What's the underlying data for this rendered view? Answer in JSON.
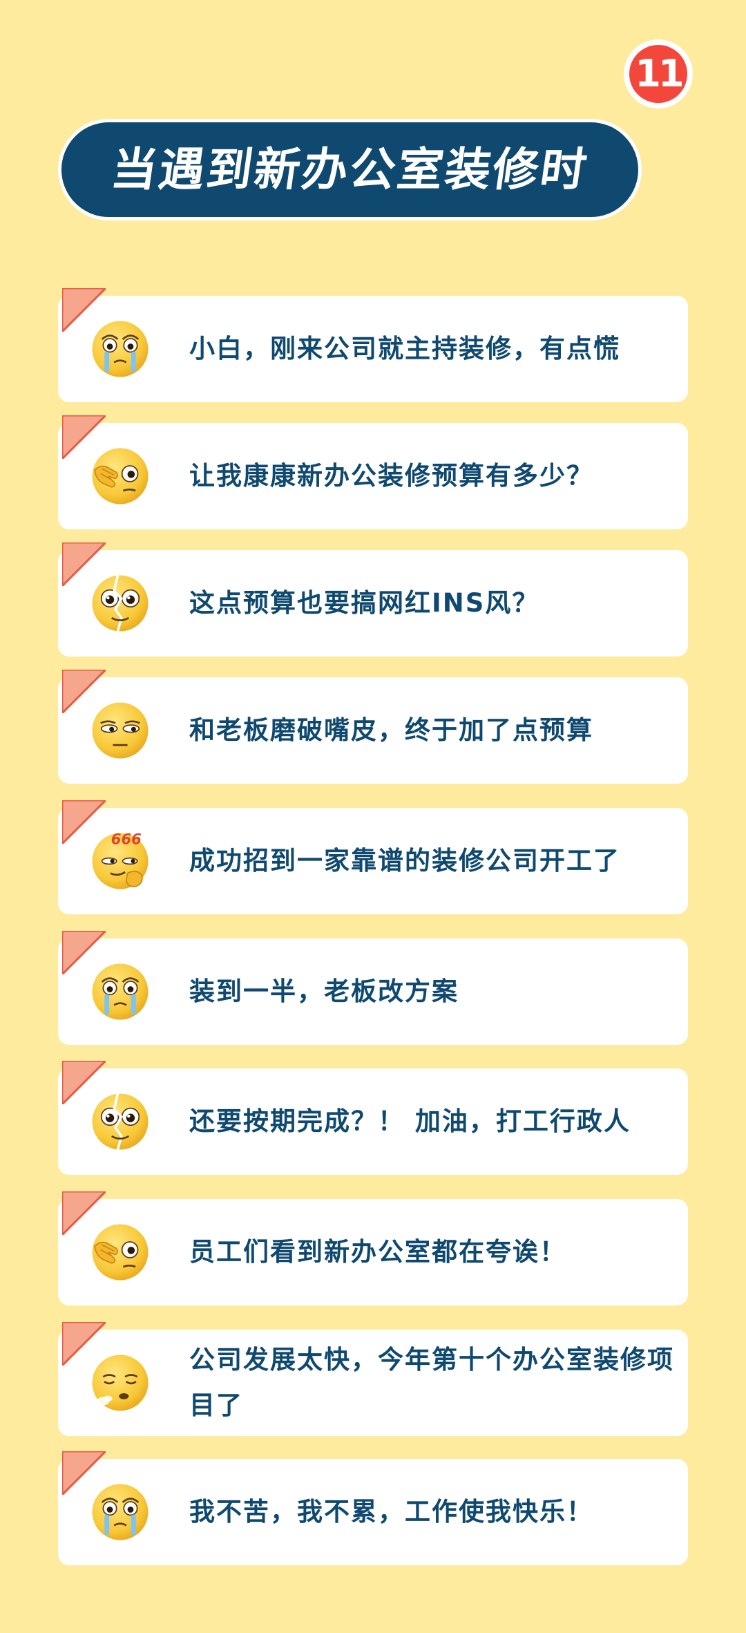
{
  "badge": {
    "label": "11"
  },
  "header": {
    "title": "当遇到新办公室装修时"
  },
  "colors": {
    "background": "#FEEB9E",
    "title_bg": "#0F4970",
    "text": "#0F4970",
    "badge": "#F2473A",
    "corner": "#F7A68E",
    "corner_border": "#E85A44"
  },
  "items": [
    {
      "emoji": "crying-face-icon",
      "text": "小白，刚来公司就主持装修，有点慌"
    },
    {
      "emoji": "peeking-face-icon",
      "text": "让我康康新办公装修预算有多少？"
    },
    {
      "emoji": "cracked-face-icon",
      "text": "这点预算也要搞网红INS风？"
    },
    {
      "emoji": "unamused-face-icon",
      "text": "和老板磨破嘴皮，终于加了点预算"
    },
    {
      "emoji": "smug-666-face-icon",
      "emoji_label": "666",
      "text": "成功招到一家靠谱的装修公司开工了"
    },
    {
      "emoji": "crying-face-icon",
      "text": "装到一半，老板改方案"
    },
    {
      "emoji": "cracked-face-icon",
      "text": "还要按期完成？！ 加油，打工行政人"
    },
    {
      "emoji": "peeking-face-icon",
      "text": "员工们看到新办公室都在夸诶！"
    },
    {
      "emoji": "sighing-face-icon",
      "text": "公司发展太快，今年第十个办公室装修项目了"
    },
    {
      "emoji": "crying-face-icon",
      "text": "我不苦，我不累，工作使我快乐！"
    }
  ]
}
